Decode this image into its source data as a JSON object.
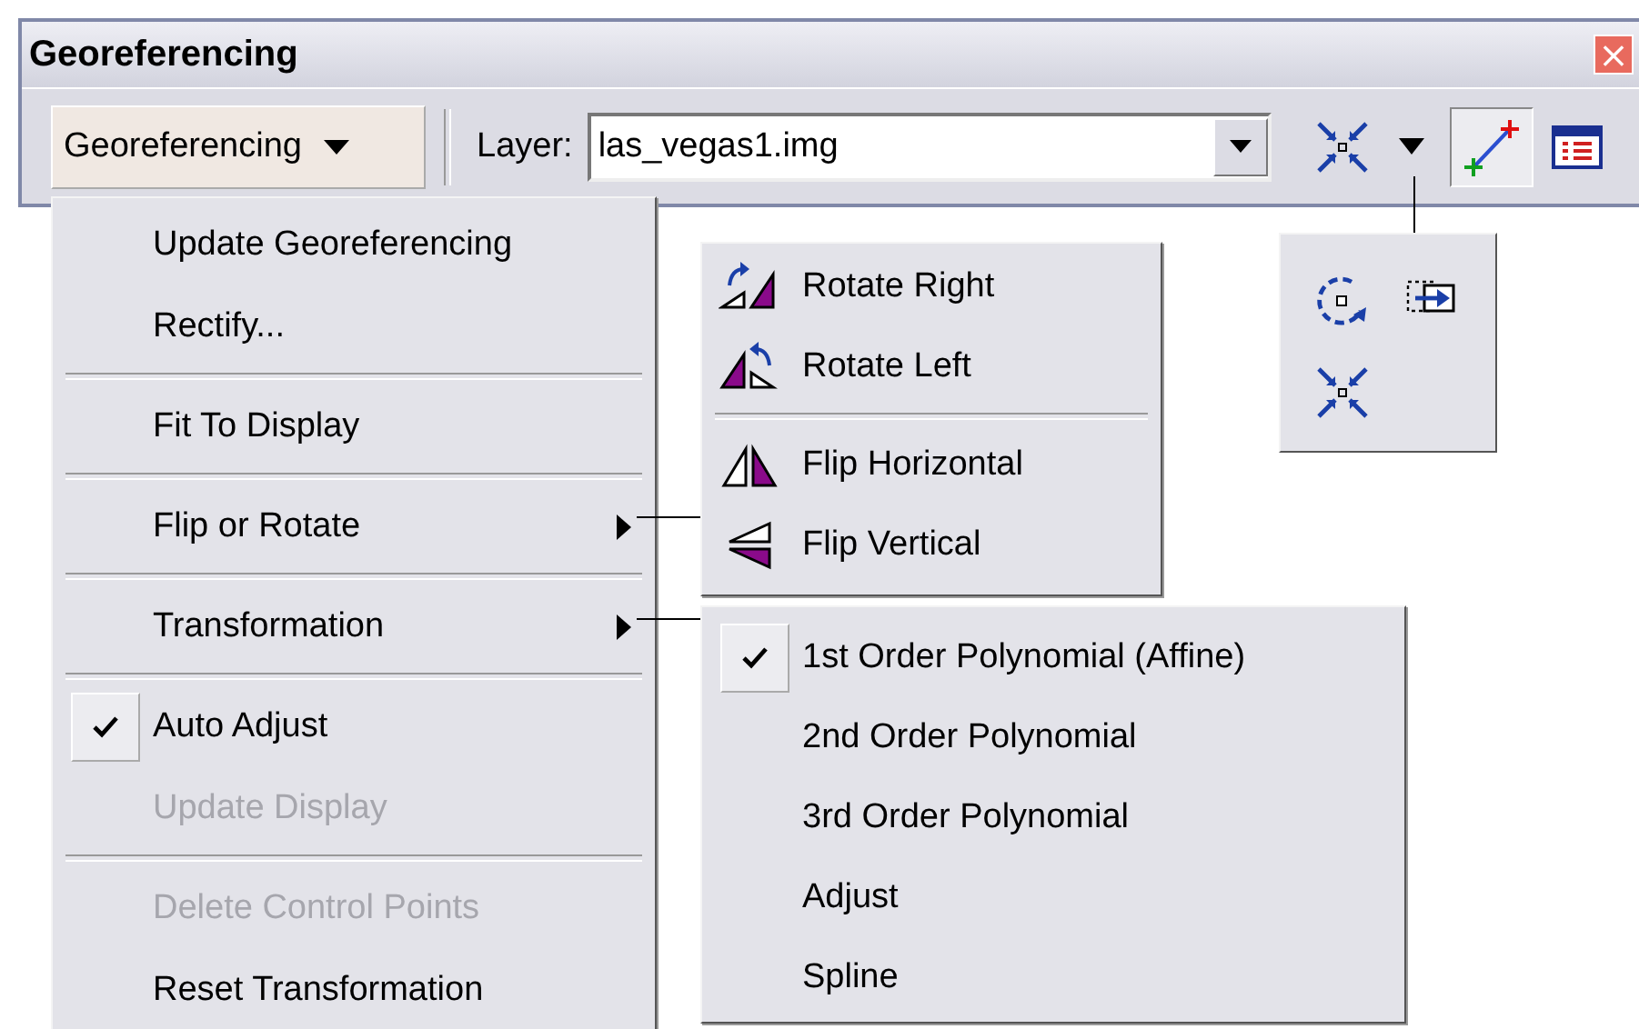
{
  "window": {
    "title": "Georeferencing",
    "close": "×"
  },
  "toolbar": {
    "menu_button": "Georeferencing",
    "layer_label": "Layer:",
    "layer_value": "las_vegas1.img"
  },
  "main_menu": [
    {
      "kind": "item",
      "label": "Update Georeferencing",
      "checked": false,
      "disabled": false
    },
    {
      "kind": "item",
      "label": "Rectify...",
      "checked": false,
      "disabled": false
    },
    {
      "kind": "separator"
    },
    {
      "kind": "item",
      "label": "Fit To Display",
      "checked": false,
      "disabled": false
    },
    {
      "kind": "separator"
    },
    {
      "kind": "submenu",
      "label": "Flip or Rotate",
      "checked": false,
      "disabled": false
    },
    {
      "kind": "separator"
    },
    {
      "kind": "submenu",
      "label": "Transformation",
      "checked": false,
      "disabled": false
    },
    {
      "kind": "separator"
    },
    {
      "kind": "item",
      "label": "Auto Adjust",
      "checked": true,
      "disabled": false
    },
    {
      "kind": "item",
      "label": "Update Display",
      "checked": false,
      "disabled": true
    },
    {
      "kind": "separator"
    },
    {
      "kind": "item",
      "label": "Delete Control Points",
      "checked": false,
      "disabled": true
    },
    {
      "kind": "item",
      "label": "Reset Transformation",
      "checked": false,
      "disabled": false
    }
  ],
  "flip_menu": [
    {
      "kind": "item",
      "label": "Rotate Right"
    },
    {
      "kind": "item",
      "label": "Rotate Left"
    },
    {
      "kind": "separator"
    },
    {
      "kind": "item",
      "label": "Flip Horizontal"
    },
    {
      "kind": "item",
      "label": "Flip Vertical"
    }
  ],
  "transformation_menu": [
    {
      "label": "1st Order Polynomial (Affine)",
      "checked": true
    },
    {
      "label": "2nd Order Polynomial",
      "checked": false
    },
    {
      "label": "3rd Order Polynomial",
      "checked": false
    },
    {
      "label": "Adjust",
      "checked": false
    },
    {
      "label": "Spline",
      "checked": false
    }
  ]
}
